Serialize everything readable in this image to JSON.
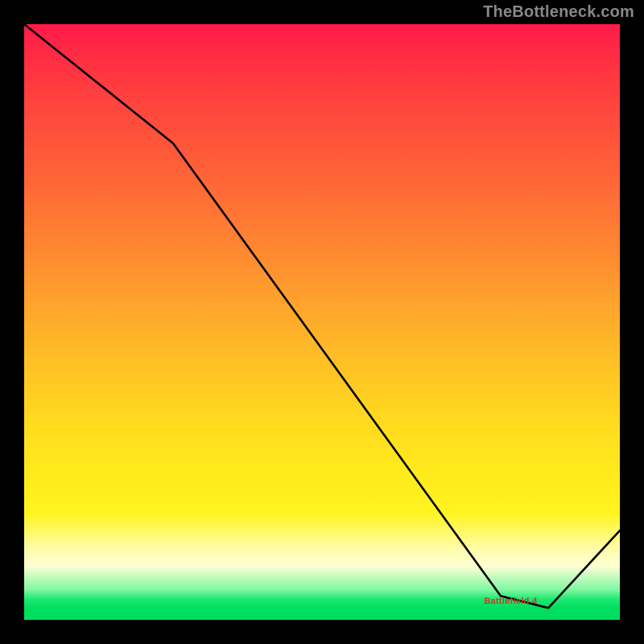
{
  "attribution": "TheBottleneck.com",
  "bar_label": "Battlefield 4",
  "chart_data": {
    "type": "line",
    "title": "",
    "xlabel": "",
    "ylabel": "",
    "xlim": [
      0,
      100
    ],
    "ylim": [
      0,
      100
    ],
    "series": [
      {
        "name": "curve",
        "x": [
          0,
          25,
          80,
          88,
          100
        ],
        "values": [
          100,
          80,
          4,
          2,
          15
        ]
      }
    ]
  }
}
